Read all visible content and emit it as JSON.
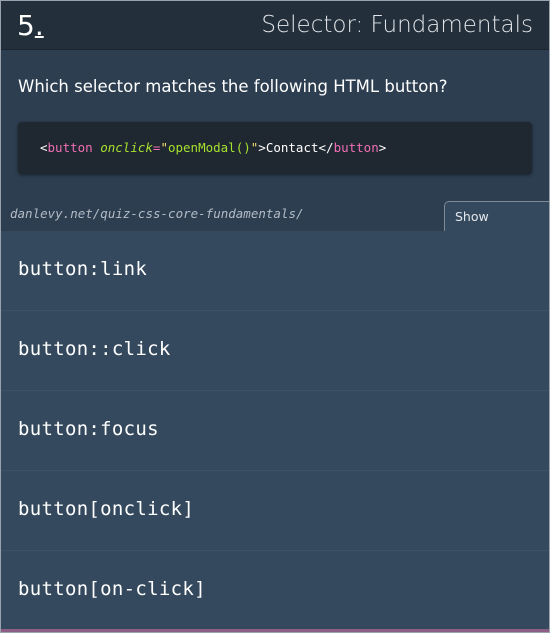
{
  "header": {
    "number": "5",
    "number_suffix": ".",
    "title": "Selector: Fundamentals"
  },
  "question": "Which selector matches the following HTML button?",
  "code": {
    "open_lt": "<",
    "tag": "button",
    "space": " ",
    "attr": "onclick",
    "eq": "=",
    "quote_open": "\"",
    "fn": "openModal()",
    "quote_close": "\"",
    "gt": ">",
    "text": "Contact",
    "close_lt": "</",
    "close_tag": "button",
    "close_gt": ">"
  },
  "source_url": "danlevy.net/quiz-css-core-fundamentals/",
  "explainer_button": "Show Explainer",
  "options": [
    "button:link",
    "button::click",
    "button:focus",
    "button[onclick]",
    "button[on-click]"
  ],
  "colors": {
    "background": "#2c3e50",
    "option_bg": "#34495e",
    "code_bg": "#1f2730",
    "tag": "#f06fb5",
    "attr": "#a6e22e",
    "string": "#f5e16b"
  }
}
